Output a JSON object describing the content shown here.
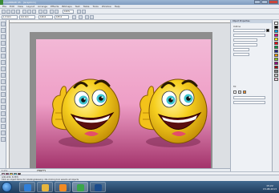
{
  "window": {
    "title": "CorelDRAW X5 - [Graphic1]",
    "controls": [
      "minimize",
      "maximize",
      "close"
    ]
  },
  "menubar": {
    "items": [
      "File",
      "Edit",
      "View",
      "Layout",
      "Arrange",
      "Effects",
      "Bitmaps",
      "Text",
      "Table",
      "Tools",
      "Window",
      "Help"
    ]
  },
  "toolbar": {
    "zoom_value": "100%",
    "x_value": "1.3 mm",
    "y_value": "0.0 mm",
    "width_value": "140.0",
    "height_value": "105.0"
  },
  "docker": {
    "title": "Object Properties",
    "outline_label": "Outline",
    "fill_label": "Fill",
    "width_label": "0.2 mm",
    "style_label": "Solid"
  },
  "document": {
    "page_label": "1 of 1",
    "tab_label": "Page 1"
  },
  "statusbar": {
    "line1": "(241.634, 8.387)",
    "line2": "Click an object twice for rotating/skewing; dbl-clicking tool selects all objects"
  },
  "taskbar": {
    "time": "15:22",
    "date": "15.08.2013"
  },
  "colors": {
    "background_pink": "#f0a3c8",
    "background_magenta": "#a8336b",
    "smiley_yellow": "#f6cf1f",
    "eye_cyan": "#3ec3cf"
  },
  "icons": {
    "start": "windows-orb-icon",
    "app1": "internet-explorer-icon",
    "app2": "folder-icon",
    "app3": "media-player-icon",
    "app4": "coreldraw-icon",
    "app5": "photoshop-icon"
  }
}
